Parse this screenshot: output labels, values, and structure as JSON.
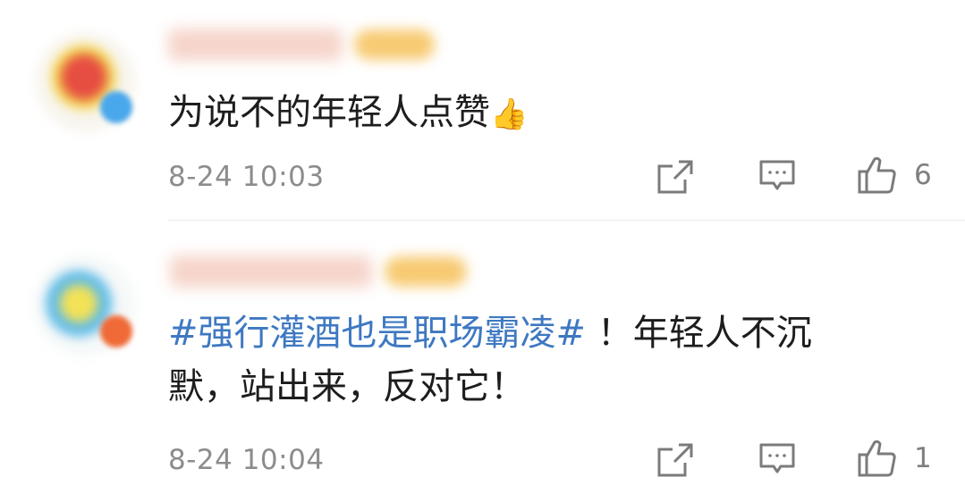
{
  "comments": [
    {
      "text": "为说不的年轻人点赞",
      "emoji": "👍",
      "time": "8-24 10:03",
      "likes": "6",
      "icons": [
        "share-icon",
        "comment-icon",
        "like-icon"
      ]
    },
    {
      "hashtag": "#强行灌酒也是职场霸凌#",
      "text_line1": "！年轻人不沉",
      "text_line2": "默，站出来，反对它！",
      "time": "8-24 10:04",
      "likes": "1",
      "icons": [
        "share-icon",
        "comment-icon",
        "like-icon"
      ]
    }
  ]
}
